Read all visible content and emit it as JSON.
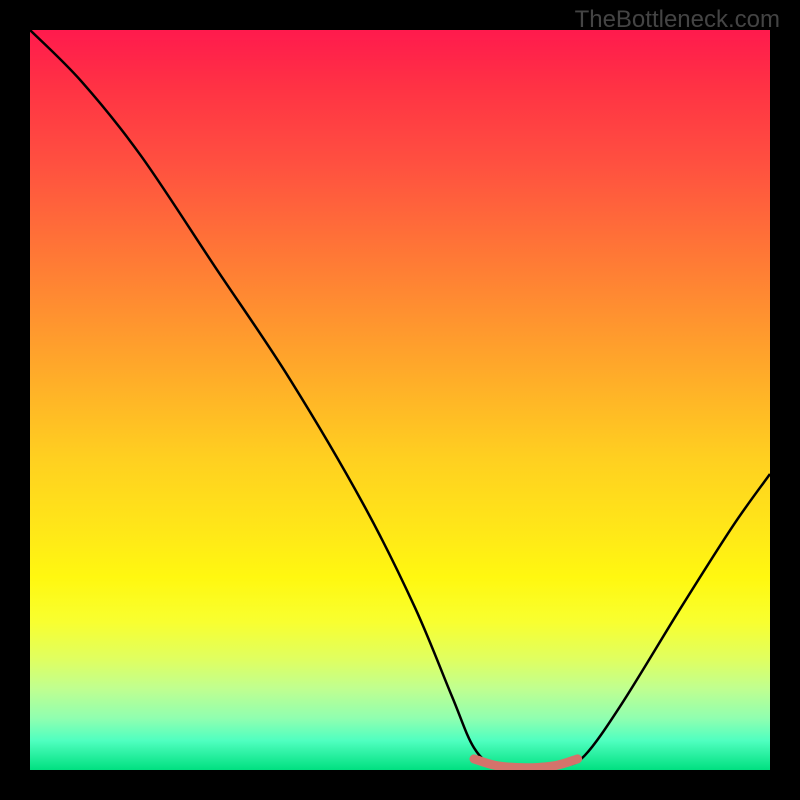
{
  "watermark": "TheBottleneck.com",
  "chart_data": {
    "type": "line",
    "title": "",
    "xlabel": "",
    "ylabel": "",
    "xlim": [
      0,
      100
    ],
    "ylim": [
      0,
      100
    ],
    "background": {
      "gradient": "vertical",
      "stops": [
        {
          "pos": 0,
          "color": "#ff1a4d"
        },
        {
          "pos": 50,
          "color": "#ffd020"
        },
        {
          "pos": 80,
          "color": "#f8ff30"
        },
        {
          "pos": 100,
          "color": "#00e080"
        }
      ]
    },
    "series": [
      {
        "name": "bottleneck-curve",
        "color": "#000000",
        "width": 2,
        "points": [
          {
            "x": 0,
            "y": 100
          },
          {
            "x": 7,
            "y": 93
          },
          {
            "x": 15,
            "y": 83
          },
          {
            "x": 25,
            "y": 68
          },
          {
            "x": 35,
            "y": 53
          },
          {
            "x": 45,
            "y": 36
          },
          {
            "x": 52,
            "y": 22
          },
          {
            "x": 57,
            "y": 10
          },
          {
            "x": 60,
            "y": 3
          },
          {
            "x": 63,
            "y": 0.5
          },
          {
            "x": 68,
            "y": 0
          },
          {
            "x": 72,
            "y": 0.5
          },
          {
            "x": 75,
            "y": 2
          },
          {
            "x": 80,
            "y": 9
          },
          {
            "x": 88,
            "y": 22
          },
          {
            "x": 95,
            "y": 33
          },
          {
            "x": 100,
            "y": 40
          }
        ]
      },
      {
        "name": "optimal-range-highlight",
        "color": "#d4736b",
        "width": 9,
        "points": [
          {
            "x": 60,
            "y": 1.5
          },
          {
            "x": 63,
            "y": 0.6
          },
          {
            "x": 67,
            "y": 0.3
          },
          {
            "x": 71,
            "y": 0.6
          },
          {
            "x": 74,
            "y": 1.5
          }
        ]
      }
    ]
  }
}
